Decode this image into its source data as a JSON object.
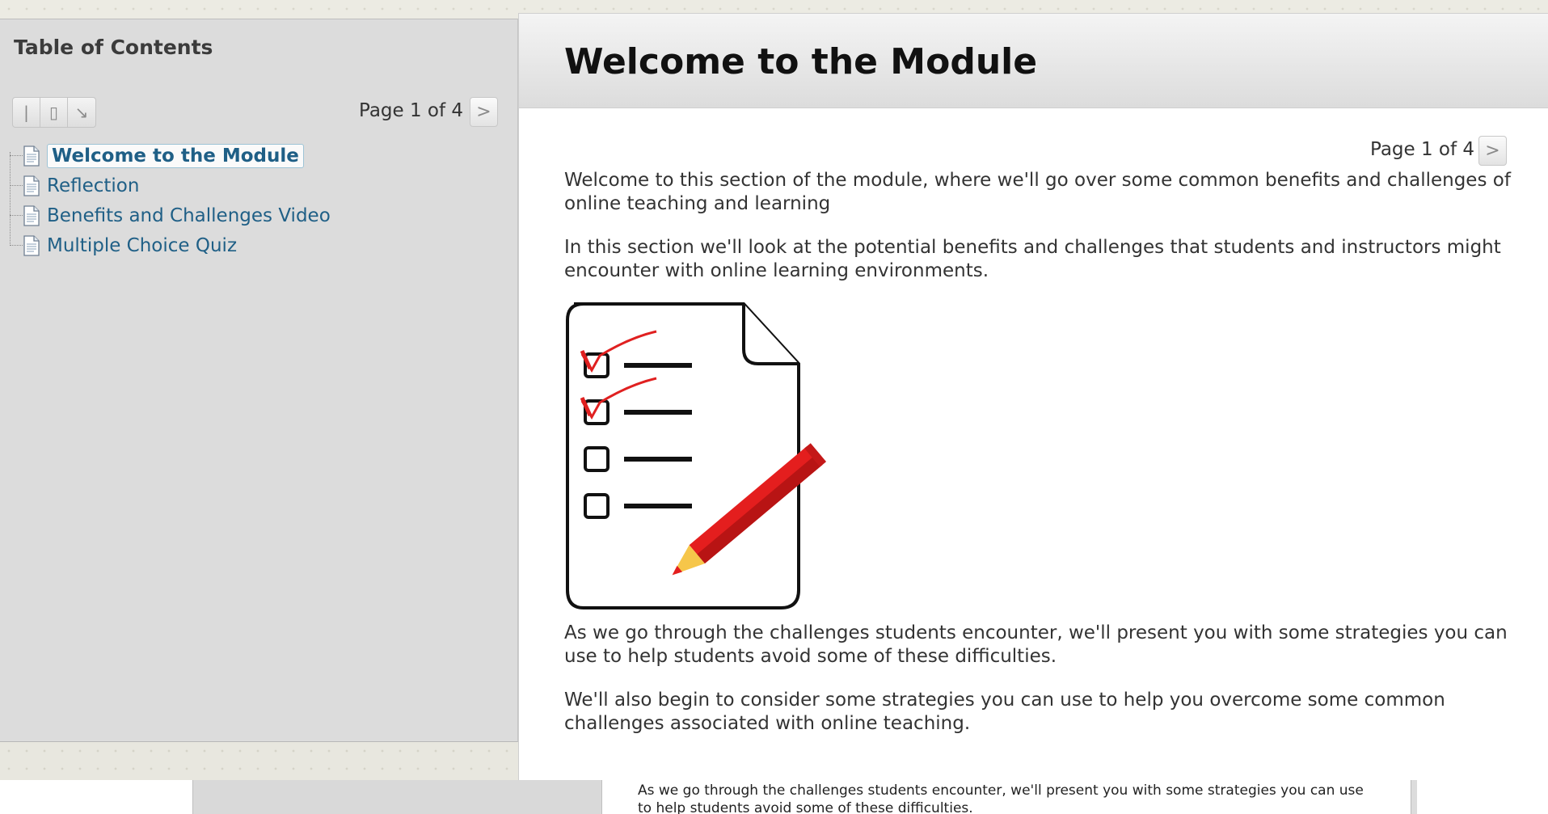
{
  "sidebar": {
    "title": "Table of Contents",
    "tools": [
      {
        "icon": "collapse-icon",
        "glyph": "|"
      },
      {
        "icon": "expand-icon",
        "glyph": "▯"
      },
      {
        "icon": "open-new-icon",
        "glyph": "↘"
      }
    ],
    "page_indicator": "Page 1 of 4",
    "next_label": ">",
    "items": [
      {
        "label": "Welcome to the Module",
        "active": true
      },
      {
        "label": "Reflection",
        "active": false
      },
      {
        "label": "Benefits and Challenges Video",
        "active": false
      },
      {
        "label": "Multiple Choice Quiz",
        "active": false
      }
    ]
  },
  "main": {
    "title": "Welcome to the Module",
    "page_indicator": "Page 1 of 4",
    "next_label": ">",
    "paragraphs": [
      "Welcome to this section of the module, where we'll go over some common benefits and challenges of online teaching and learning",
      "In this section we'll look at the potential benefits and challenges that students and instructors might encounter with online learning environments.",
      "As we go through the challenges students encounter, we'll present you with some strategies you can use to help students avoid some of these difficulties.",
      "We'll also begin to consider some strategies you can use to help you overcome some common challenges associated with online teaching."
    ],
    "image": {
      "icon": "checklist-pencil-icon",
      "checked_items": 2,
      "total_items": 4
    }
  },
  "background_window": {
    "text": "As we go through the challenges students encounter, we'll present you with some strategies you can use to help students avoid some of these difficulties."
  },
  "colors": {
    "link": "#1f5f86",
    "sidebar_bg": "#dcdcdc",
    "pencil_red": "#e41e1e",
    "check_red": "#e02020"
  }
}
